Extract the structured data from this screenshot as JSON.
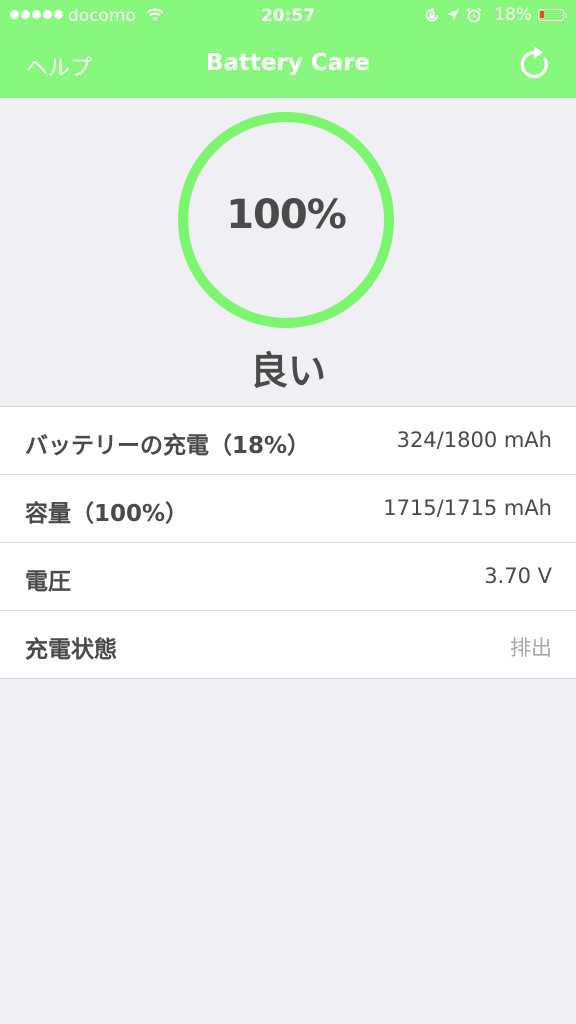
{
  "status_bar": {
    "carrier": "docomo",
    "time": "20:57",
    "battery_percent": "18%",
    "battery_level": 0.18
  },
  "nav": {
    "help_label": "ヘルプ",
    "title": "Battery Care"
  },
  "gauge": {
    "value_text": "100%",
    "value": 100,
    "health_label": "良い",
    "accent_color": "#7cf56f"
  },
  "rows": [
    {
      "label": "バッテリーの充電（18%）",
      "value": "324/1800 mAh"
    },
    {
      "label": "容量（100%）",
      "value": "1715/1715 mAh"
    },
    {
      "label": "電圧",
      "value": "3.70 V"
    },
    {
      "label": "充電状態",
      "value": "排出"
    }
  ],
  "colors": {
    "header": "#87f77d",
    "background": "#efeff4",
    "battery_low": "#ff3b30"
  }
}
